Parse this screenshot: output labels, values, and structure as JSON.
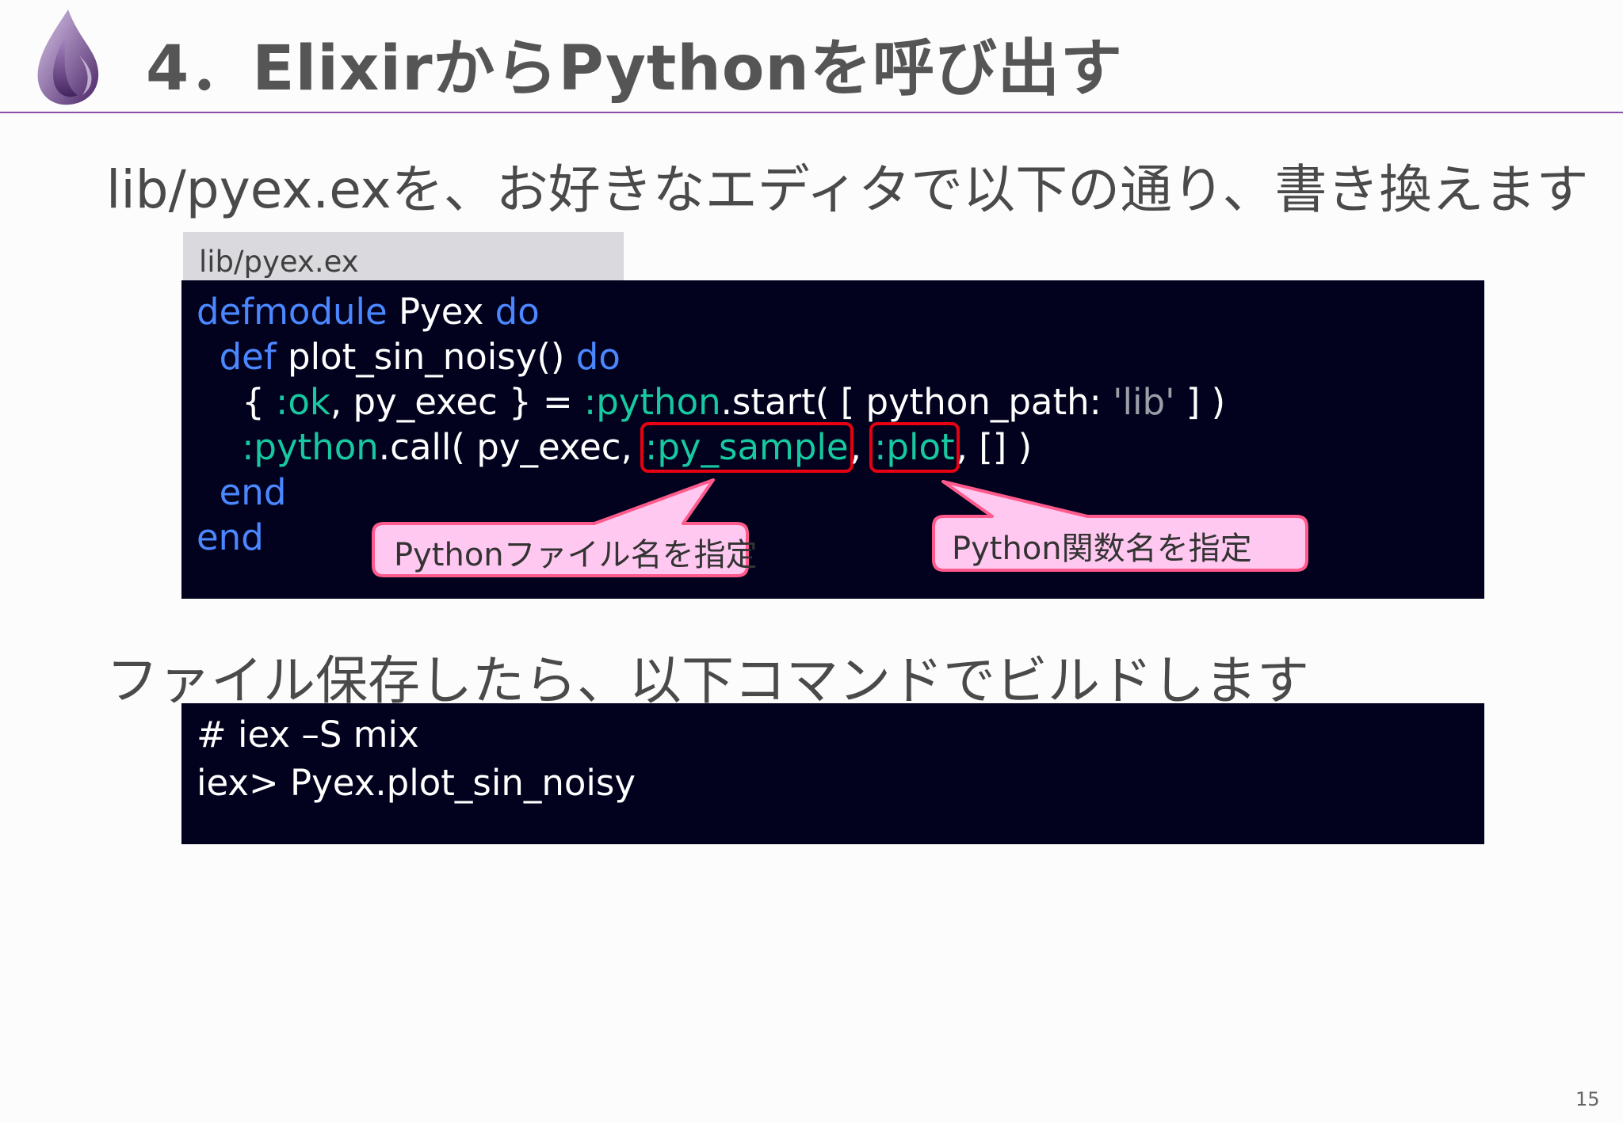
{
  "title": "4．ElixirからPythonを呼び出す",
  "heading1": "lib/pyex.exを、お好きなエディタで以下の通り、書き換えます",
  "file_tab": "lib/pyex.ex",
  "code1": {
    "l1_kw1": "defmodule",
    "l1_name": " Pyex ",
    "l1_kw2": "do",
    "l2_indent": "  ",
    "l2_kw": "def",
    "l2_name": " plot_sin_noisy() ",
    "l2_kw2": "do",
    "l3_a": "    { ",
    "l3_ok": ":ok",
    "l3_b": ", py_exec } = ",
    "l3_python": ":python",
    "l3_c": ".start( [ python_path: ",
    "l3_str": "'lib'",
    "l3_d": " ] )",
    "l4_a": "    ",
    "l4_python": ":python",
    "l4_b": ".call( py_exec, ",
    "l4_sample": ":py_sample",
    "l4_c": ", ",
    "l4_plot": ":plot",
    "l4_d": ", [] )",
    "l5": "  end",
    "l6": "end"
  },
  "callouts": {
    "file_name": "Pythonファイル名を指定",
    "func_name": "Python関数名を指定"
  },
  "heading2": "ファイル保存したら、以下コマンドでビルドします",
  "code2": {
    "l1": "# iex –S mix",
    "l2": "iex> Pyex.plot_sin_noisy"
  },
  "page_number": "15",
  "colors": {
    "accent": "#8a4fa8",
    "code_bg": "#02021f",
    "keyword": "#4b87ff",
    "atom": "#17c9a0",
    "highlight": "#e60012",
    "callout_fill": "#ffc8f0",
    "callout_border": "#ff5a8c"
  },
  "icons": {
    "logo": "elixir-drop-logo"
  }
}
